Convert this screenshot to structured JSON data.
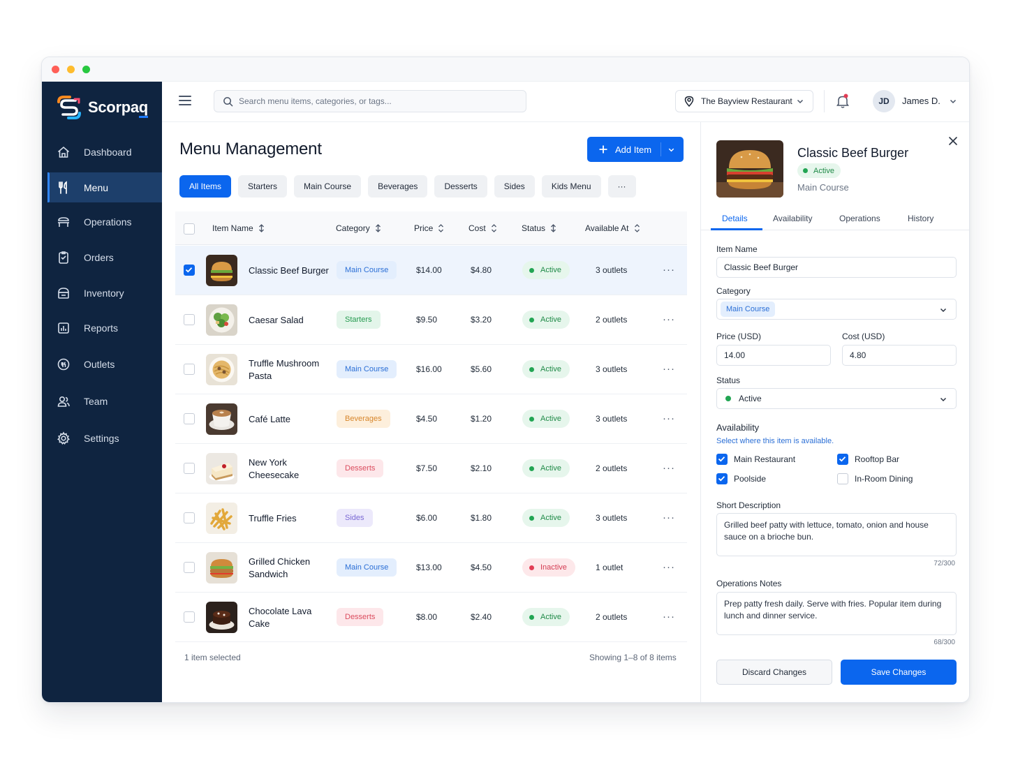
{
  "colors": {
    "sidebar_bg": "#0f2440",
    "accent": "#0b66ee",
    "active_status": "#22a553",
    "inactive_status": "#e23d55"
  },
  "brand": {
    "name_main": "Scorpa",
    "name_tail": "q"
  },
  "sidebar": {
    "items": [
      {
        "label": "Dashboard",
        "icon": "home-icon"
      },
      {
        "label": "Menu",
        "icon": "utensils-icon",
        "active": true
      },
      {
        "label": "Operations",
        "icon": "counter-icon"
      },
      {
        "label": "Orders",
        "icon": "clipboard-icon"
      },
      {
        "label": "Inventory",
        "icon": "box-icon"
      },
      {
        "label": "Reports",
        "icon": "bar-chart-icon"
      },
      {
        "label": "Outlets",
        "icon": "store-icon"
      },
      {
        "label": "Team",
        "icon": "users-icon"
      },
      {
        "label": "Settings",
        "icon": "gear-icon"
      }
    ]
  },
  "topbar": {
    "search_placeholder": "Search menu items, categories, or tags...",
    "restaurant": "The Bayview Restaurant",
    "user_initials": "JD",
    "user_name": "James D."
  },
  "main": {
    "title": "Menu Management",
    "add_button": "Add Item",
    "filters": [
      "All Items",
      "Starters",
      "Main Course",
      "Beverages",
      "Desserts",
      "Sides",
      "Kids Menu",
      "···"
    ],
    "active_filter": "All Items",
    "columns": [
      "Item Name",
      "Category",
      "Price",
      "Cost",
      "Status",
      "Available At"
    ],
    "rows": [
      {
        "name": "Classic Beef Burger",
        "category": "Main Course",
        "price": "$14.00",
        "cost": "$4.80",
        "status": "Active",
        "available": "3 outlets",
        "selected": true
      },
      {
        "name": "Caesar Salad",
        "category": "Starters",
        "price": "$9.50",
        "cost": "$3.20",
        "status": "Active",
        "available": "2 outlets",
        "selected": false
      },
      {
        "name": "Truffle Mushroom Pasta",
        "category": "Main Course",
        "price": "$16.00",
        "cost": "$5.60",
        "status": "Active",
        "available": "3 outlets",
        "selected": false
      },
      {
        "name": "Café Latte",
        "category": "Beverages",
        "price": "$4.50",
        "cost": "$1.20",
        "status": "Active",
        "available": "3 outlets",
        "selected": false
      },
      {
        "name": "New York Cheesecake",
        "category": "Desserts",
        "price": "$7.50",
        "cost": "$2.10",
        "status": "Active",
        "available": "2 outlets",
        "selected": false
      },
      {
        "name": "Truffle Fries",
        "category": "Sides",
        "price": "$6.00",
        "cost": "$1.80",
        "status": "Active",
        "available": "3 outlets",
        "selected": false
      },
      {
        "name": "Grilled Chicken Sandwich",
        "category": "Main Course",
        "price": "$13.00",
        "cost": "$4.50",
        "status": "Inactive",
        "available": "1 outlet",
        "selected": false
      },
      {
        "name": "Chocolate Lava Cake",
        "category": "Desserts",
        "price": "$8.00",
        "cost": "$2.40",
        "status": "Active",
        "available": "2 outlets",
        "selected": false
      }
    ],
    "selection_text": "1 item selected",
    "showing_text": "Showing 1–8 of 8 items"
  },
  "panel": {
    "title": "Classic Beef Burger",
    "status": "Active",
    "category_sub": "Main Course",
    "tabs": [
      "Details",
      "Availability",
      "Operations",
      "History"
    ],
    "active_tab": "Details",
    "item_name_label": "Item Name",
    "item_name_value": "Classic Beef Burger",
    "category_label": "Category",
    "category_value": "Main Course",
    "price_label": "Price (USD)",
    "price_value": "14.00",
    "cost_label": "Cost (USD)",
    "cost_value": "4.80",
    "status_label": "Status",
    "status_value": "Active",
    "availability_label": "Availability",
    "availability_hint": "Select where this item is available.",
    "locations": [
      {
        "label": "Main Restaurant",
        "checked": true
      },
      {
        "label": "Rooftop Bar",
        "checked": true
      },
      {
        "label": "Poolside",
        "checked": true
      },
      {
        "label": "In-Room Dining",
        "checked": false
      }
    ],
    "short_desc_label": "Short Description",
    "short_desc": "Grilled beef patty with lettuce, tomato, onion and house sauce on a brioche bun.",
    "short_desc_count": "72/300",
    "ops_notes_label": "Operations Notes",
    "ops_notes": "Prep patty fresh daily. Serve with fries. Popular item during lunch and dinner service.",
    "ops_notes_count": "68/300",
    "discard_label": "Discard Changes",
    "save_label": "Save Changes"
  }
}
